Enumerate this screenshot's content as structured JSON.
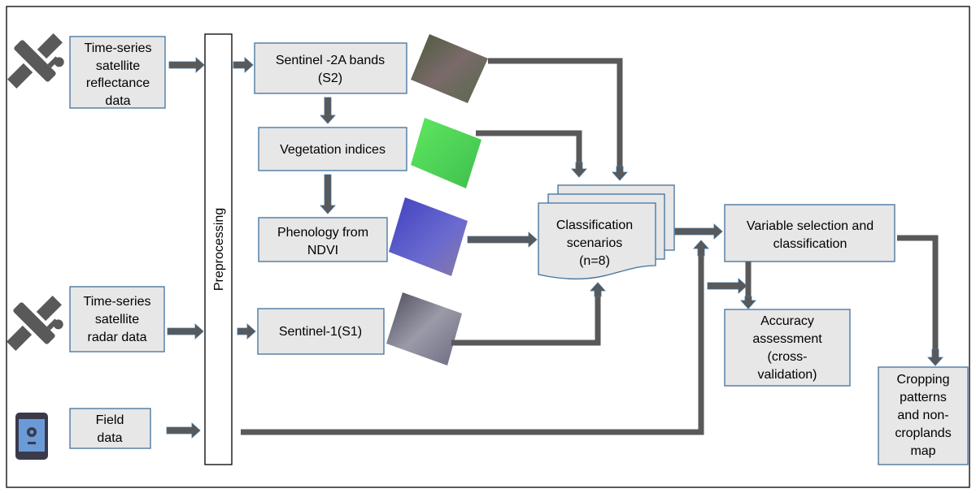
{
  "inputs": {
    "reflectance": [
      "Time-series",
      "satellite",
      "reflectance",
      "data"
    ],
    "radar": [
      "Time-series",
      "satellite",
      "radar data"
    ],
    "field": [
      "Field",
      "data"
    ]
  },
  "preprocessing": "Preprocessing",
  "sentinel2": [
    "Sentinel -2A bands",
    "(S2)"
  ],
  "vegetation_indices": [
    "Vegetation indices"
  ],
  "phenology": [
    "Phenology from",
    "NDVI"
  ],
  "sentinel1": [
    "Sentinel-1(S1)"
  ],
  "classification_scenarios": [
    "Classification",
    "scenarios",
    "(n=8)"
  ],
  "variable_selection": [
    "Variable selection and",
    "classification"
  ],
  "accuracy": [
    "Accuracy",
    "assessment",
    "(cross-",
    "validation)"
  ],
  "output_map": [
    "Cropping",
    "patterns",
    "and non-",
    "croplands",
    "map"
  ],
  "icons": [
    "satellite-icon",
    "satellite-icon",
    "smartphone-location-icon"
  ],
  "colors": {
    "box_fill": "#e7e7e7",
    "box_stroke": "#41719c",
    "arrow": "#595959"
  }
}
